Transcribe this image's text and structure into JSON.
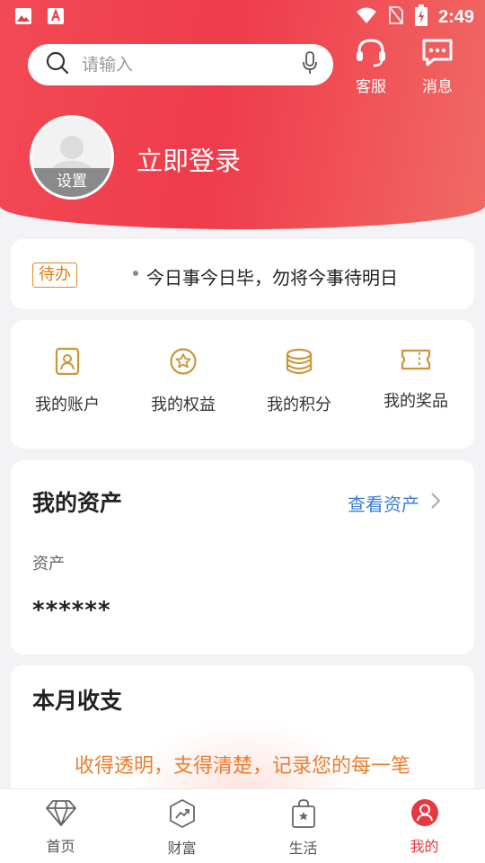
{
  "status_bar": {
    "time": "2:49"
  },
  "search": {
    "placeholder": "请输入"
  },
  "top_actions": {
    "service": "客服",
    "messages": "消息"
  },
  "profile": {
    "avatar_settings": "设置",
    "login": "立即登录"
  },
  "todo": {
    "badge": "待办",
    "text": "今日事今日毕，勿将今事待明日"
  },
  "quick_links": [
    {
      "label": "我的账户",
      "icon": "account-card-icon"
    },
    {
      "label": "我的权益",
      "icon": "star-badge-icon"
    },
    {
      "label": "我的积分",
      "icon": "coins-icon"
    },
    {
      "label": "我的奖品",
      "icon": "ticket-icon"
    }
  ],
  "assets": {
    "title": "我的资产",
    "view_link": "查看资产",
    "label": "资产",
    "value": "******"
  },
  "monthly": {
    "title": "本月收支",
    "slogan": "收得透明，支得清楚，记录您的每一笔"
  },
  "bottom_nav": [
    {
      "label": "首页",
      "icon": "diamond-icon",
      "active": false
    },
    {
      "label": "财富",
      "icon": "trend-icon",
      "active": false
    },
    {
      "label": "生活",
      "icon": "shopping-bag-icon",
      "active": false
    },
    {
      "label": "我的",
      "icon": "user-icon",
      "active": true
    }
  ],
  "colors": {
    "brand_red": "#ef3b4b",
    "accent_orange": "#e07d18",
    "link_blue": "#3b7fd0",
    "icon_gold": "#c9963a"
  }
}
